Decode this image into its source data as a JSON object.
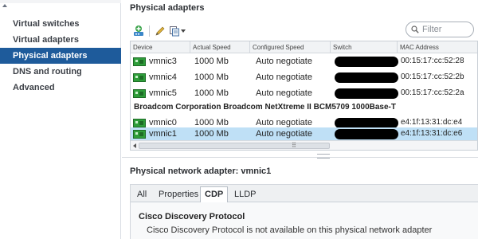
{
  "sidebar": {
    "items": [
      {
        "label": "Virtual switches",
        "active": false
      },
      {
        "label": "Virtual adapters",
        "active": false
      },
      {
        "label": "Physical adapters",
        "active": true
      },
      {
        "label": "DNS and routing",
        "active": false
      },
      {
        "label": "Advanced",
        "active": false
      }
    ]
  },
  "main": {
    "title": "Physical adapters",
    "toolbar": {
      "icons": [
        "add-network-icon",
        "edit-pencil-icon",
        "copy-settings-icon"
      ]
    },
    "filter": {
      "placeholder": "Filter",
      "value": ""
    },
    "grid": {
      "columns": [
        "Device",
        "Actual Speed",
        "Configured Speed",
        "Switch",
        "MAC Address"
      ],
      "rows": [
        {
          "device": "vmnic3",
          "actual_speed": "1000 Mb",
          "configured_speed": "Auto negotiate",
          "mac": "00:15:17:cc:52:28",
          "selected": false
        },
        {
          "device": "vmnic4",
          "actual_speed": "1000 Mb",
          "configured_speed": "Auto negotiate",
          "mac": "00:15:17:cc:52:2b",
          "selected": false
        },
        {
          "device": "vmnic5",
          "actual_speed": "1000 Mb",
          "configured_speed": "Auto negotiate",
          "mac": "00:15:17:cc:52:2a",
          "selected": false
        }
      ],
      "group_label": "Broadcom Corporation Broadcom NetXtreme II BCM5709 1000Base-T",
      "group_rows": [
        {
          "device": "vmnic0",
          "actual_speed": "1000 Mb",
          "configured_speed": "Auto negotiate",
          "mac": "e4:1f:13:31:dc:e4",
          "selected": false
        },
        {
          "device": "vmnic1",
          "actual_speed": "1000 Mb",
          "configured_speed": "Auto negotiate",
          "mac": "e4:1f:13:31:dc:e6",
          "selected": true
        }
      ],
      "scroll_grip": "⠿"
    },
    "detail": {
      "title": "Physical network adapter: vmnic1",
      "tabs": [
        {
          "label": "All",
          "active": false
        },
        {
          "label": "Properties",
          "active": false
        },
        {
          "label": "CDP",
          "active": true
        },
        {
          "label": "LLDP",
          "active": false
        }
      ],
      "cdp": {
        "heading": "Cisco Discovery Protocol",
        "message": "Cisco Discovery Protocol is not available on this physical network adapter"
      }
    }
  },
  "colors": {
    "sidebar_active_bg": "#1e5b9b",
    "selected_row_bg": "#bfe0f6",
    "nic_icon_green": "#2e9e3a"
  }
}
